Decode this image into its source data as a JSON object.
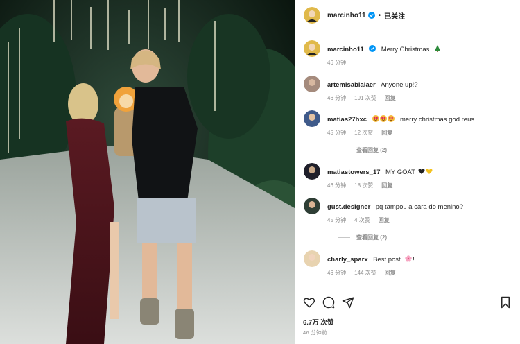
{
  "post": {
    "author": "marcinho11",
    "follow_state": "已关注",
    "separator": "•",
    "caption": "Merry Christmas",
    "caption_time": "46 分钟",
    "likes": "6.7万 次赞",
    "posted_ago": "46 分钟前"
  },
  "comments": [
    {
      "user": "artemisabialaer",
      "text": "Anyone up!?",
      "time": "46 分钟",
      "likes": "191 次赞",
      "reply": "回复",
      "view_replies": ""
    },
    {
      "user": "matias27hxc",
      "text": "merry christmas god reus",
      "time": "45 分钟",
      "likes": "12 次赞",
      "reply": "回复",
      "view_replies": "查看回复 (2)"
    },
    {
      "user": "matiastowers_17",
      "text": "MY GOAT",
      "time": "46 分钟",
      "likes": "18 次赞",
      "reply": "回复",
      "view_replies": ""
    },
    {
      "user": "gust.designer",
      "text": "pq tampou a cara do menino?",
      "time": "45 分钟",
      "likes": "4 次赞",
      "reply": "回复",
      "view_replies": "查看回复 (2)"
    },
    {
      "user": "charly_sparx",
      "text": "Best post",
      "text_suffix": "!",
      "time": "46 分钟",
      "likes": "144 次赞",
      "reply": "回复",
      "view_replies": ""
    }
  ],
  "icons": {
    "verified": "verified-badge-icon",
    "like": "heart-icon",
    "comment": "comment-bubble-icon",
    "share": "paper-plane-icon",
    "save": "bookmark-icon"
  },
  "colors": {
    "verified": "#0095f6",
    "text": "#262626",
    "secondary": "#8e8e8e",
    "border": "#efefef"
  }
}
